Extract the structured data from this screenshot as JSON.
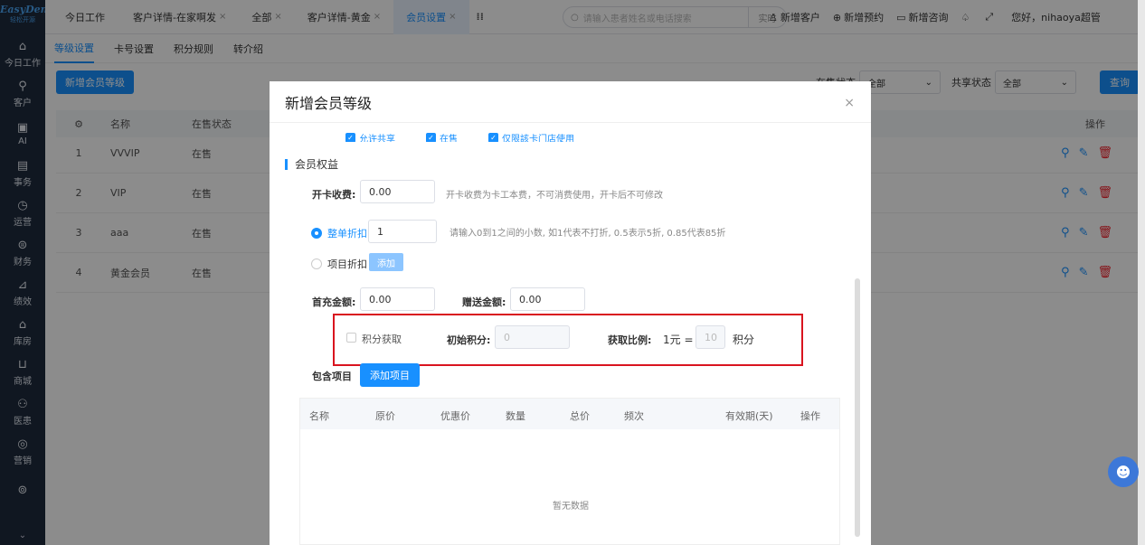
{
  "sidebar": {
    "brand": "EasyDent",
    "brand_sub": "轻松开源",
    "items": [
      {
        "icon": "⌂",
        "label": "今日工作"
      },
      {
        "icon": "⚲",
        "label": "客户"
      },
      {
        "icon": "▣",
        "label": "AI"
      },
      {
        "icon": "▤",
        "label": "事务"
      },
      {
        "icon": "◷",
        "label": "运营"
      },
      {
        "icon": "⊜",
        "label": "财务"
      },
      {
        "icon": "⊿",
        "label": "绩效"
      },
      {
        "icon": "⌂",
        "label": "库房"
      },
      {
        "icon": "⊔",
        "label": "商城"
      },
      {
        "icon": "⚇",
        "label": "医患"
      },
      {
        "icon": "◎",
        "label": "营销"
      },
      {
        "icon": "⊚",
        "label": ""
      }
    ],
    "bottom_icon": "⌄"
  },
  "tabs": [
    {
      "label": "今日工作",
      "closable": ""
    },
    {
      "label": "客户详情-在家啊发",
      "closable": "×"
    },
    {
      "label": "全部",
      "closable": "×"
    },
    {
      "label": "客户详情-黄金",
      "closable": "×"
    },
    {
      "label": "会员设置",
      "closable": "×"
    }
  ],
  "grid_icon": "⁞⁞",
  "search": {
    "placeholder": "请输入患者姓名或电话搜索",
    "realtime": "实时"
  },
  "top_actions": [
    {
      "icon": "♙",
      "label": "新增客户"
    },
    {
      "icon": "⊕",
      "label": "新增预约"
    },
    {
      "icon": "▭",
      "label": "新增咨询"
    },
    {
      "icon": "♤",
      "label": ""
    },
    {
      "icon": "⤢",
      "label": ""
    },
    {
      "icon": "",
      "label": "您好，nihaoya超管"
    }
  ],
  "subtabs": [
    "等级设置",
    "卡号设置",
    "积分规则",
    "转介绍"
  ],
  "page": {
    "add_level": "新增会员等级",
    "status_label": "在售状态",
    "status_value": "全部",
    "share_label": "共享状态",
    "share_value": "全部",
    "query": "查询",
    "columns": [
      "⚙",
      "名称",
      "在售状态"
    ],
    "ops_header": "操作",
    "rows": [
      {
        "no": "1",
        "name": "VVVIP",
        "status": "在售"
      },
      {
        "no": "2",
        "name": "VIP",
        "status": "在售"
      },
      {
        "no": "3",
        "name": "aaa",
        "status": "在售"
      },
      {
        "no": "4",
        "name": "黄金会员",
        "status": "在售"
      }
    ]
  },
  "modal": {
    "title": "新增会员等级",
    "close": "×",
    "cut_checks": [
      "允许共享",
      "在售",
      "仅限該卡门店使用"
    ],
    "section": "会员权益",
    "open_fee_label": "开卡收费:",
    "open_fee_value": "0.00",
    "open_fee_hint": "开卡收费为卡工本费，不可消费使用，开卡后不可修改",
    "discount_label": "整单折扣",
    "discount_value": "1",
    "discount_hint": "请输入0到1之间的小数, 如1代表不打折, 0.5表示5折, 0.85代表85折",
    "item_discount_label": "项目折扣",
    "add_small": "添加",
    "first_charge_label": "首充金额:",
    "first_charge_value": "0.00",
    "gift_label": "赠送金额:",
    "gift_value": "0.00",
    "points_check": "积分获取",
    "init_points_label": "初始积分:",
    "init_points_value": "0",
    "ratio_label": "获取比例:",
    "ratio_prefix": "1元 =",
    "ratio_value": "10",
    "ratio_suffix": "积分",
    "include_label": "包含项目",
    "add_item": "添加项目",
    "table_columns": [
      "名称",
      "原价",
      "优惠价",
      "数量",
      "总价",
      "频次",
      "有效期(天)",
      "操作"
    ],
    "empty": "暂无数据"
  }
}
